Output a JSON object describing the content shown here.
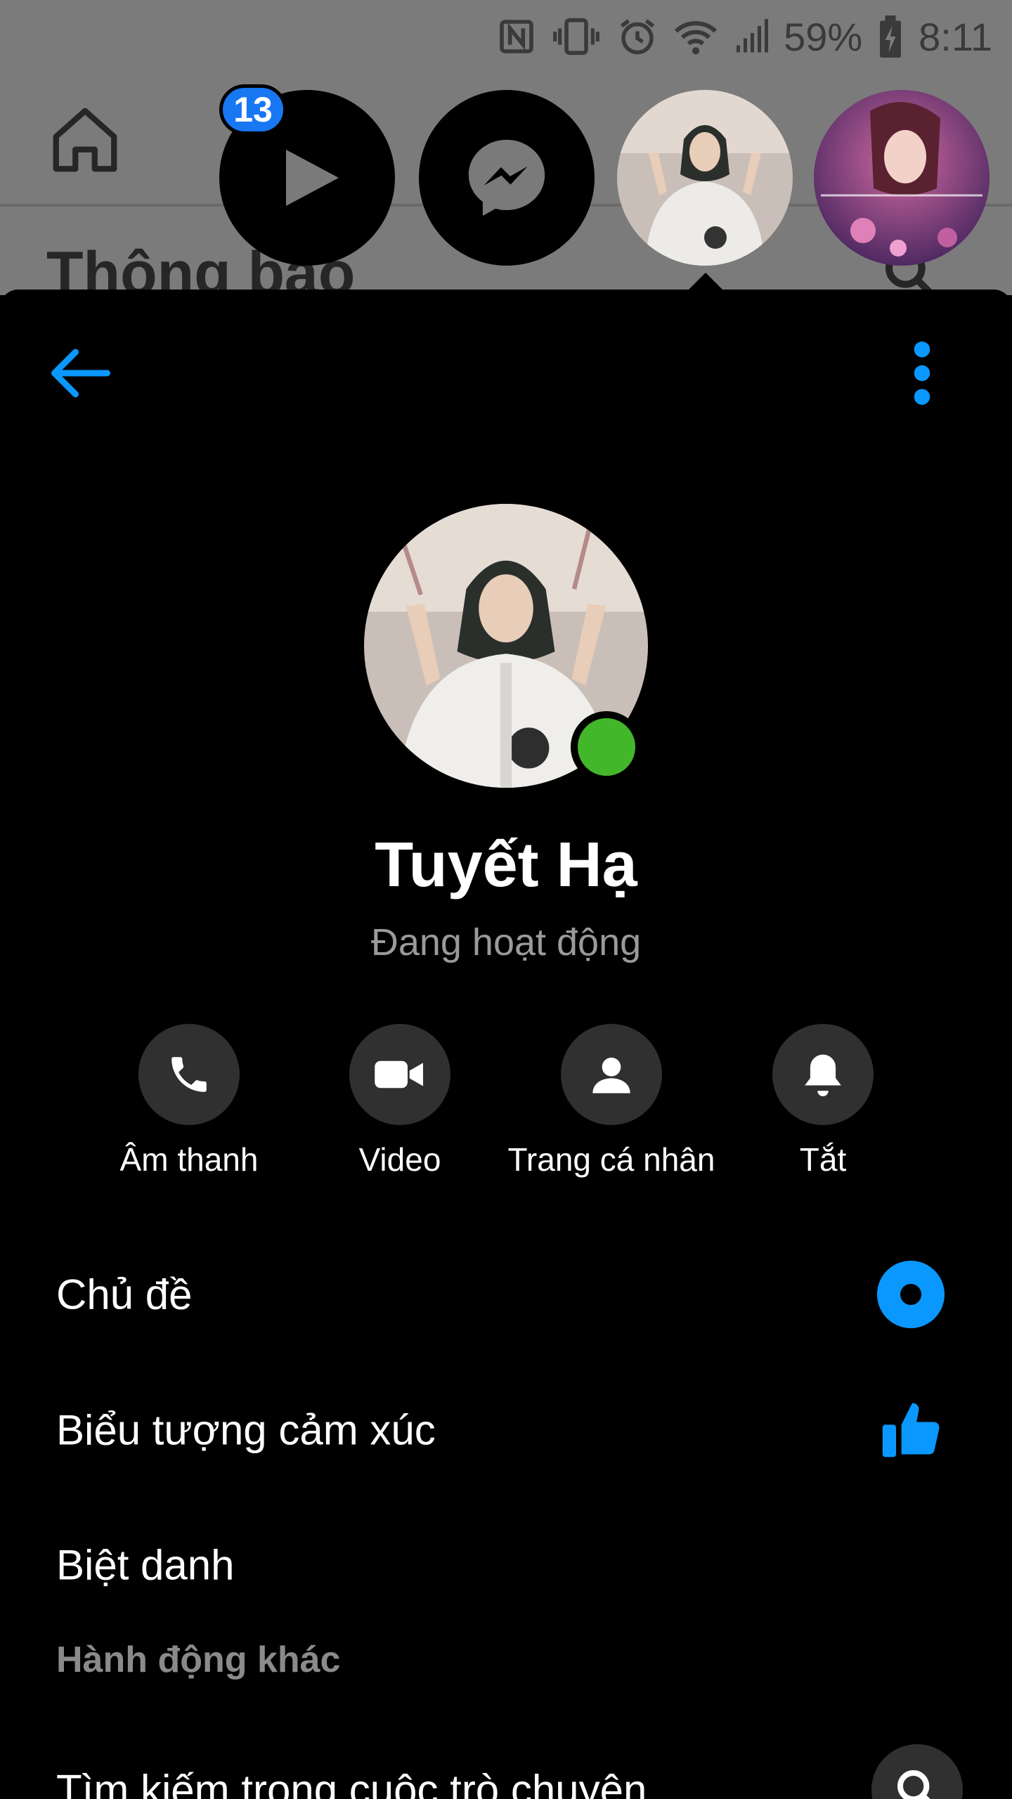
{
  "status_bar": {
    "battery": "59%",
    "time": "8:11",
    "icons": [
      "nfc-icon",
      "vibrate-icon",
      "alarm-icon",
      "wifi-icon",
      "signal-icon",
      "battery-icon"
    ]
  },
  "background_app": {
    "title": "Thông báo",
    "nav_icons": [
      "home-icon",
      "groups-icon",
      "watch-icon",
      "notifications-icon"
    ]
  },
  "chat_heads": {
    "badge_count": "13",
    "items": [
      "video-player-head",
      "messenger-head",
      "contact-head-active",
      "contact-head-anime"
    ]
  },
  "profile": {
    "name": "Tuyết Hạ",
    "status": "Đang hoạt động",
    "online": true
  },
  "actions": [
    {
      "label": "Âm thanh",
      "icon": "phone-icon"
    },
    {
      "label": "Video",
      "icon": "video-camera-icon"
    },
    {
      "label": "Trang cá nhân",
      "icon": "person-icon"
    },
    {
      "label": "Tắt",
      "icon": "bell-icon"
    }
  ],
  "settings": {
    "theme_label": "Chủ đề",
    "emoji_label": "Biểu tượng cảm xúc",
    "nickname_label": "Biệt danh",
    "section_more": "Hành động khác",
    "search_label": "Tìm kiếm trong cuộc trò chuyện"
  },
  "colors": {
    "accent": "#0a98ff",
    "online": "#42b72a",
    "badge": "#1877f2",
    "sheet_bg": "#000000",
    "action_circle": "#303030",
    "secondary_text": "#9a9a9a"
  }
}
